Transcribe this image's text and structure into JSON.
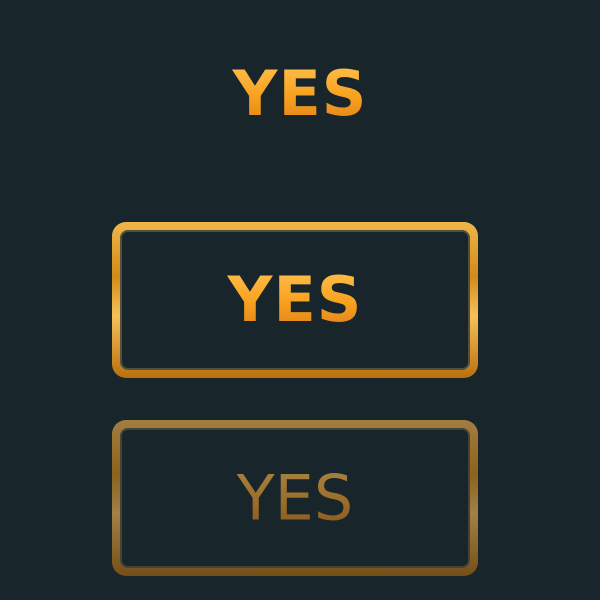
{
  "labels": {
    "title": "YES",
    "button_primary": "YES",
    "button_disabled": "YES"
  },
  "colors": {
    "background": "#18252a",
    "gold_light": "#ffbf4d",
    "gold_mid": "#f7a11e",
    "gold_dark": "#e0801b"
  }
}
